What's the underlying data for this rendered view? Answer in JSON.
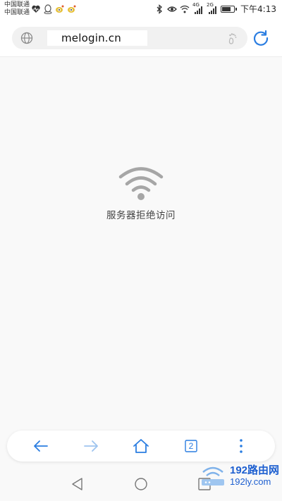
{
  "status_bar": {
    "carrier_1": "中国联通",
    "carrier_2": "中国联通",
    "net_1": "4G",
    "net_2": "2G",
    "time": "下午4:13",
    "battery_level": 0.8,
    "icons": [
      "heart-icon",
      "qq-icon",
      "weibo-icon",
      "weibo-icon",
      "bluetooth-icon",
      "eye-icon",
      "wifi-icon",
      "signal-icon",
      "signal-icon",
      "battery-icon"
    ]
  },
  "address_bar": {
    "url": "melogin.cn",
    "left_icon": "globe-icon",
    "right_icon": "footprint-icon",
    "action_icon": "refresh-icon"
  },
  "content": {
    "error_icon": "wifi-error-icon",
    "error_message": "服务器拒绝访问"
  },
  "toolbar": {
    "back_icon": "back-arrow-icon",
    "forward_icon": "forward-arrow-icon",
    "home_icon": "home-icon",
    "tabs_count": "2",
    "menu_icon": "more-vertical-icon"
  },
  "navbar": {
    "back_icon": "nav-back-icon",
    "home_icon": "nav-home-icon",
    "recents_icon": "nav-recents-icon"
  },
  "watermark": {
    "title": "192路由网",
    "domain": "192ly.com"
  },
  "colors": {
    "accent": "#2a7de1",
    "disabled": "#9ec4ef",
    "icon_grey": "#a6a6a6",
    "watermark": "#1d5fd0"
  }
}
